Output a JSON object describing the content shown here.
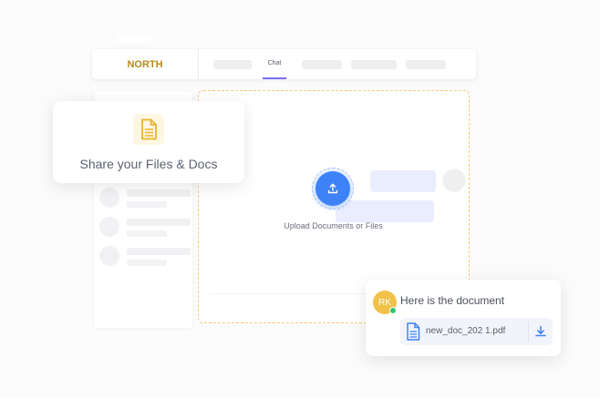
{
  "app": {
    "brand": "NORTH",
    "active_tab": "Chat"
  },
  "share_card": {
    "icon": "document-icon",
    "label": "Share your Files & Docs"
  },
  "upload": {
    "icon": "upload-icon",
    "label": "Upload Documents or Files"
  },
  "message": {
    "avatar_initials": "RK",
    "text": "Here is the document",
    "file_name": "new_doc_202 1.pdf",
    "file_icon": "document-icon",
    "download_icon": "download-icon"
  },
  "colors": {
    "brand": "#b48c1c",
    "accent": "#3e82f7",
    "tab_indicator": "#7b6cf5",
    "dropzone_border": "#f2cd72",
    "avatar_bg": "#f1c14a",
    "online": "#34c46e"
  }
}
